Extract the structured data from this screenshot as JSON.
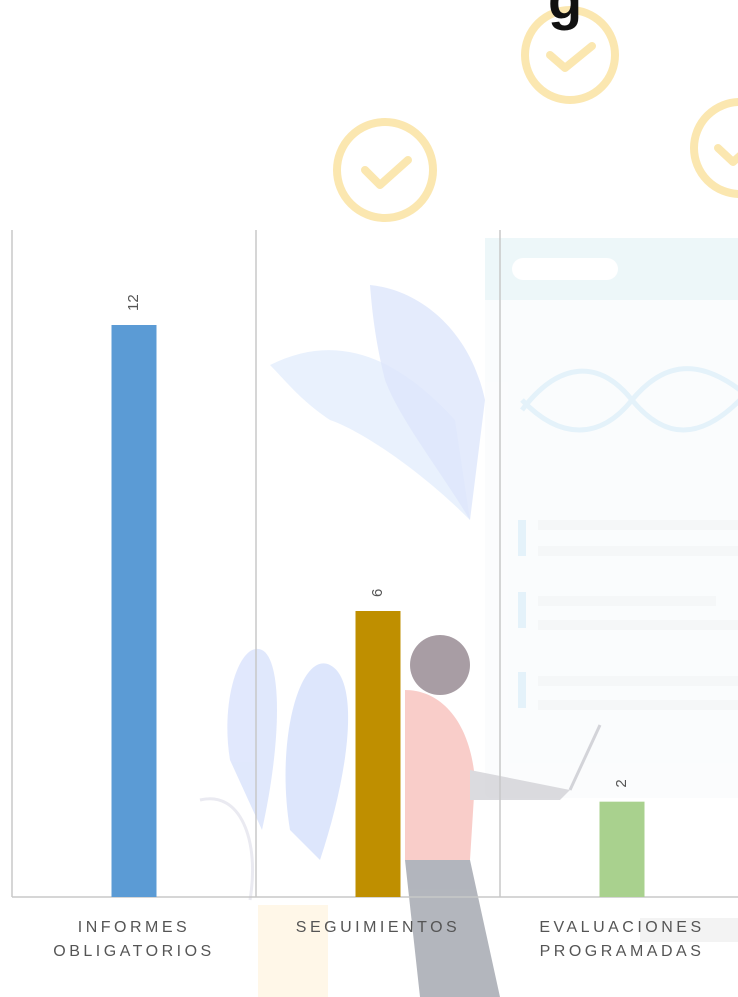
{
  "header": {
    "title_fragment": "g"
  },
  "chart_data": {
    "type": "bar",
    "title": "",
    "xlabel": "",
    "ylabel": "",
    "ylim": [
      0,
      14
    ],
    "grid": false,
    "legend": "none",
    "categories": [
      [
        "INFORMES",
        "OBLIGATORIOS"
      ],
      [
        "SEGUIMIENTOS"
      ],
      [
        "EVALUACIONES",
        "PROGRAMADAS"
      ]
    ],
    "values": [
      12,
      6,
      2
    ],
    "data_labels": [
      "12",
      "6",
      "2"
    ],
    "colors": [
      "#5B9BD5",
      "#BF8F00",
      "#A9D18E"
    ]
  },
  "colors": {
    "axis": "#c8c8c8",
    "divider": "#c8c8c8",
    "label": "#555555",
    "check_icon": "#fbe7b0"
  }
}
